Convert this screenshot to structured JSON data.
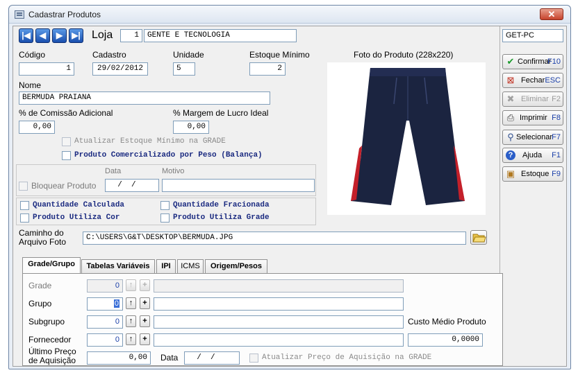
{
  "window": {
    "title": "Cadastrar Produtos",
    "close_label": "✕"
  },
  "header": {
    "loja_label": "Loja",
    "loja_code": "1",
    "loja_name": "GENTE E TECNOLOGIA",
    "machine": "GET-PC"
  },
  "fields": {
    "codigo_label": "Código",
    "codigo_value": "1",
    "cadastro_label": "Cadastro",
    "cadastro_value": "29/02/2012",
    "unidade_label": "Unidade",
    "unidade_value": "5",
    "estoque_min_label": "Estoque Mínimo",
    "estoque_min_value": "2",
    "nome_label": "Nome",
    "nome_value": "BERMUDA PRAIANA",
    "comissao_label": "% de Comissão Adicional",
    "comissao_value": "0,00",
    "margem_label": "% Margem de Lucro Ideal",
    "margem_value": "0,00"
  },
  "checks": {
    "atualizar_estoque": "Atualizar Estoque Mínimo na GRADE",
    "comercializado_peso": "Produto Comercializado por Peso (Balança)",
    "bloquear_produto": "Bloquear Produto",
    "quantidade_calculada": "Quantidade Calculada",
    "quantidade_fracionada": "Quantidade Fracionada",
    "produto_utiliza_cor": "Produto Utiliza Cor",
    "produto_utiliza_grade": "Produto Utiliza Grade"
  },
  "bloqueio": {
    "data_label": "Data",
    "motivo_label": "Motivo",
    "data_value": "  /  /"
  },
  "photo": {
    "title": "Foto do Produto (228x220)",
    "caminho_label": "Caminho do Arquivo Foto",
    "caminho_value": "C:\\USERS\\G&T\\DESKTOP\\BERMUDA.JPG"
  },
  "buttons": [
    {
      "label": "Confirmar",
      "key": "F10",
      "icon": "check-icon",
      "enabled": true
    },
    {
      "label": "Fechar",
      "key": "ESC",
      "icon": "close-door-icon",
      "enabled": true
    },
    {
      "label": "Eliminar",
      "key": "F2",
      "icon": "delete-x-icon",
      "enabled": false
    },
    {
      "label": "Imprimir",
      "key": "F8",
      "icon": "printer-icon",
      "enabled": true
    },
    {
      "label": "Selecionar",
      "key": "F7",
      "icon": "magnifier-icon",
      "enabled": true
    },
    {
      "label": "Ajuda",
      "key": "F1",
      "icon": "help-icon",
      "enabled": true
    },
    {
      "label": "Estoque",
      "key": "F9",
      "icon": "box-icon",
      "enabled": true
    }
  ],
  "tabs": [
    {
      "label": "Grade/Grupo",
      "active": true
    },
    {
      "label": "Tabelas Variáveis",
      "active": false
    },
    {
      "label": "IPI",
      "active": false
    },
    {
      "label": "ICMS",
      "active": false
    },
    {
      "label": "Origem/Pesos",
      "active": false
    }
  ],
  "grade_grupo": {
    "grade_label": "Grade",
    "grade_value": "0",
    "grupo_label": "Grupo",
    "grupo_value": "0",
    "subgrupo_label": "Subgrupo",
    "subgrupo_value": "0",
    "fornecedor_label": "Fornecedor",
    "fornecedor_value": "0",
    "ultimo_preco_label": "Último Preço de Aquisição",
    "ultimo_preco_value": "0,00",
    "data_label": "Data",
    "data_value": "  /  /",
    "custo_medio_label": "Custo Médio Produto",
    "custo_medio_value": "0,0000",
    "atualizar_preco_label": "Atualizar Preço de Aquisição na GRADE"
  },
  "colors": {
    "nav_blue": "#1a4fae",
    "key_blue": "#1a3fa8",
    "check_label_blue": "#1a2a80",
    "shorts_navy": "#1b2440",
    "shorts_red": "#c4202a"
  }
}
